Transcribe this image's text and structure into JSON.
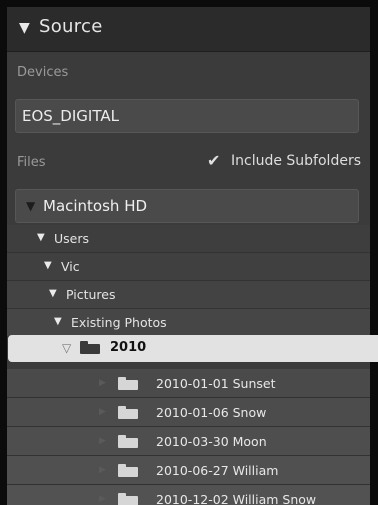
{
  "panel": {
    "title": "Source"
  },
  "devices": {
    "label": "Devices",
    "items": [
      "EOS_DIGITAL"
    ]
  },
  "files": {
    "label": "Files",
    "include_subfolders": {
      "label": "Include Subfolders",
      "checked": true
    },
    "volume": "Macintosh HD"
  },
  "tree": {
    "users": "Users",
    "vic": "Vic",
    "pictures": "Pictures",
    "existing_photos": "Existing Photos",
    "selected_folder": "2010",
    "children": [
      "2010-01-01 Sunset",
      "2010-01-06 Snow",
      "2010-03-30 Moon",
      "2010-06-27 William",
      "2010-12-02 William Snow"
    ]
  },
  "colors": {
    "panel_bg": "#3b3b3b",
    "header_bg": "#2b2b2b",
    "selected_bg": "#e2e2e2",
    "folder_icon_light": "#d8d8d8",
    "folder_icon_dark": "#3a3a3a"
  }
}
